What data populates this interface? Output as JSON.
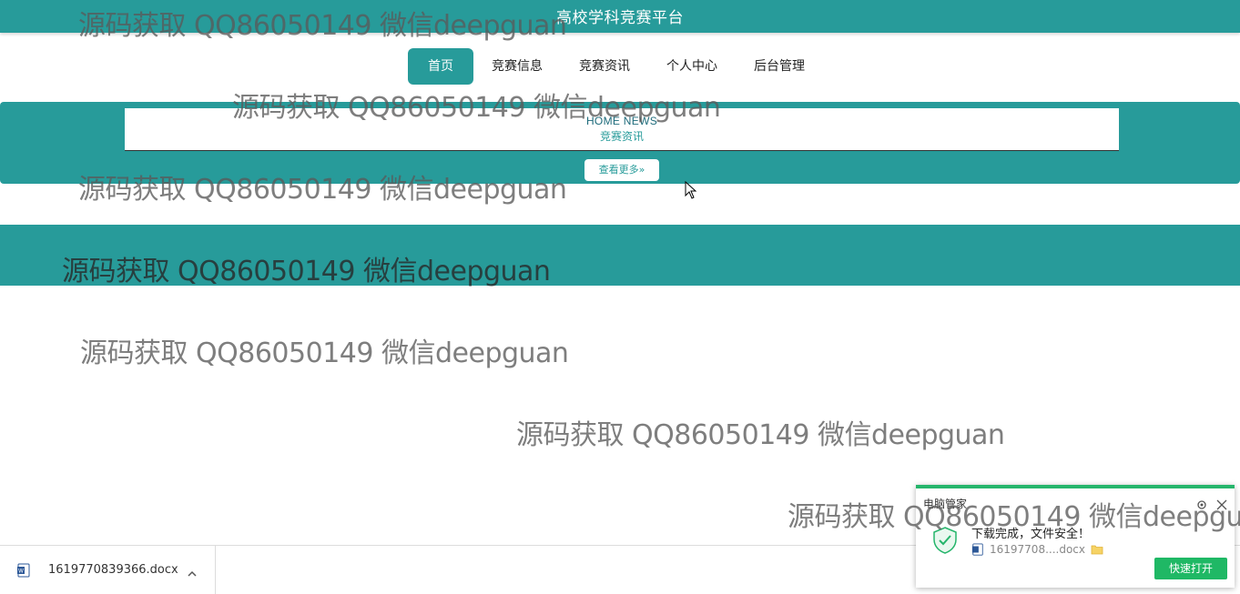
{
  "header": {
    "title": "高校学科竞赛平台"
  },
  "nav": {
    "items": [
      {
        "label": "首页",
        "active": true
      },
      {
        "label": "竞赛信息",
        "active": false
      },
      {
        "label": "竞赛资讯",
        "active": false
      },
      {
        "label": "个人中心",
        "active": false
      },
      {
        "label": "后台管理",
        "active": false
      }
    ]
  },
  "news": {
    "heading_en": "HOME NEWS",
    "heading_cn": "竞赛资讯",
    "more_button": "查看更多»"
  },
  "watermark": {
    "text": "源码获取 QQ86050149 微信deepguan"
  },
  "downloads": {
    "filename": "1619770839366.docx"
  },
  "popup": {
    "title": "电脑管家",
    "message": "下载完成，文件安全！",
    "file": "16197708....docx",
    "open_button": "快速打开"
  },
  "colors": {
    "primary": "#279b9a",
    "popup_accent": "#25b56b",
    "open_button": "#1fb865"
  }
}
